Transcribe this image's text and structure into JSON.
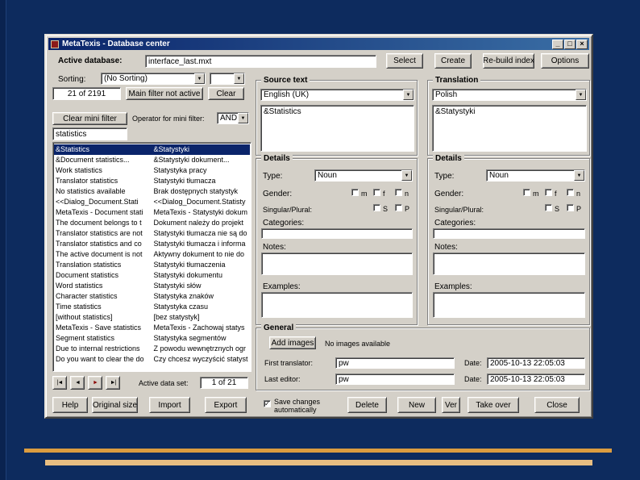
{
  "glyphs": {
    "dropdown": "▼",
    "check": "✓",
    "minimize": "_",
    "maximize": "□",
    "close": "×",
    "nav_first": "|◄",
    "nav_prev": "◄",
    "nav_next": "►",
    "nav_last": "►|"
  },
  "window": {
    "title": "MetaTexis - Database center"
  },
  "header": {
    "active_database_label": "Active database:",
    "active_database_value": "interface_last.mxt",
    "select": "Select",
    "create": "Create",
    "rebuild_index": "Re-build index",
    "options": "Options"
  },
  "sorting": {
    "label": "Sorting:",
    "value": "(No Sorting)",
    "value2": ""
  },
  "filters": {
    "count": "21 of 2191",
    "main_filter": "Main filter not active",
    "clear": "Clear",
    "clear_mini_filter": "Clear mini filter",
    "operator_label": "Operator for mini filter:",
    "operator_value": "AND",
    "mini_filter_value": "statistics"
  },
  "source_panel": {
    "group_label": "Source text",
    "language": "English (UK)",
    "text": "&Statistics"
  },
  "translation_panel": {
    "group_label": "Translation",
    "language": "Polish",
    "text": "&Statystyki"
  },
  "details": {
    "group_label": "Details",
    "type_label": "Type:",
    "gender_label": "Gender:",
    "gender_m": "m",
    "gender_f": "f",
    "gender_n": "n",
    "singular_plural_label": "Singular/Plural:",
    "singular": "S",
    "plural": "P",
    "categories_label": "Categories:",
    "notes_label": "Notes:",
    "examples_label": "Examples:",
    "source_type_value": "Noun",
    "translation_type_value": "Noun"
  },
  "general": {
    "group_label": "General",
    "add_images": "Add images",
    "no_images": "No images available",
    "first_translator_label": "First translator:",
    "first_translator_value": "pw",
    "date_label": "Date:",
    "first_date": "2005-10-13 22:05:03",
    "last_editor_label": "Last editor:",
    "last_editor_value": "pw",
    "last_date": "2005-10-13 22:05:03"
  },
  "navigation": {
    "active_data_set_label": "Active data set:",
    "active_data_set_value": "1 of 21"
  },
  "footer": {
    "help": "Help",
    "original_size": "Original size",
    "import": "Import",
    "export": "Export",
    "save_changes": "Save changes automatically",
    "delete": "Delete",
    "new": "New",
    "ver": "Ver",
    "take_over": "Take over",
    "close": "Close"
  },
  "list": {
    "selected_index": 0,
    "rows": [
      {
        "source": "&Statistics",
        "target": "&Statystyki"
      },
      {
        "source": "&Document statistics...",
        "target": "&Statystyki dokument..."
      },
      {
        "source": "Work statistics",
        "target": "Statystyka pracy"
      },
      {
        "source": "Translator statistics",
        "target": "Statystyki tłumacza"
      },
      {
        "source": "No statistics available",
        "target": "Brak dostępnych statystyk"
      },
      {
        "source": "<<Dialog_Document.Stati",
        "target": "<<Dialog_Document.Statisty"
      },
      {
        "source": "MetaTexis - Document stati",
        "target": "MetaTexis - Statystyki dokum"
      },
      {
        "source": "The document belongs to t",
        "target": "Dokument należy do projekt"
      },
      {
        "source": "Translator statistics are not",
        "target": "Statystyki tłumacza nie są do"
      },
      {
        "source": "Translator statistics and co",
        "target": "Statystyki tłumacza i informa"
      },
      {
        "source": "The active document is not",
        "target": "Aktywny dokument to nie do"
      },
      {
        "source": "Translation statistics",
        "target": "Statystyki tłumaczenia"
      },
      {
        "source": "Document statistics",
        "target": "Statystyki dokumentu"
      },
      {
        "source": "Word statistics",
        "target": "Statystyki słów"
      },
      {
        "source": "Character statistics",
        "target": "Statystyka znaków"
      },
      {
        "source": "Time statistics",
        "target": "Statystyka czasu"
      },
      {
        "source": "[without statistics]",
        "target": "[bez statystyk]"
      },
      {
        "source": "MetaTexis - Save statistics",
        "target": "MetaTexis - Zachowaj statys"
      },
      {
        "source": "Segment statistics",
        "target": "Statystyka segmentów"
      },
      {
        "source": "Due to internal restrictions",
        "target": "Z powodu wewnętrznych ogr"
      },
      {
        "source": "Do you want to clear the do",
        "target": "Czy chcesz wyczyścić statyst"
      }
    ]
  },
  "colors": {
    "slide_bg": "#0D2B5E",
    "accent_bar_1": "#DB9C40",
    "accent_bar_2": "#E8BE82",
    "titlebar": "#0A246A",
    "selection_highlight": "#0A246A",
    "window_chrome": "#D4D0C8"
  }
}
